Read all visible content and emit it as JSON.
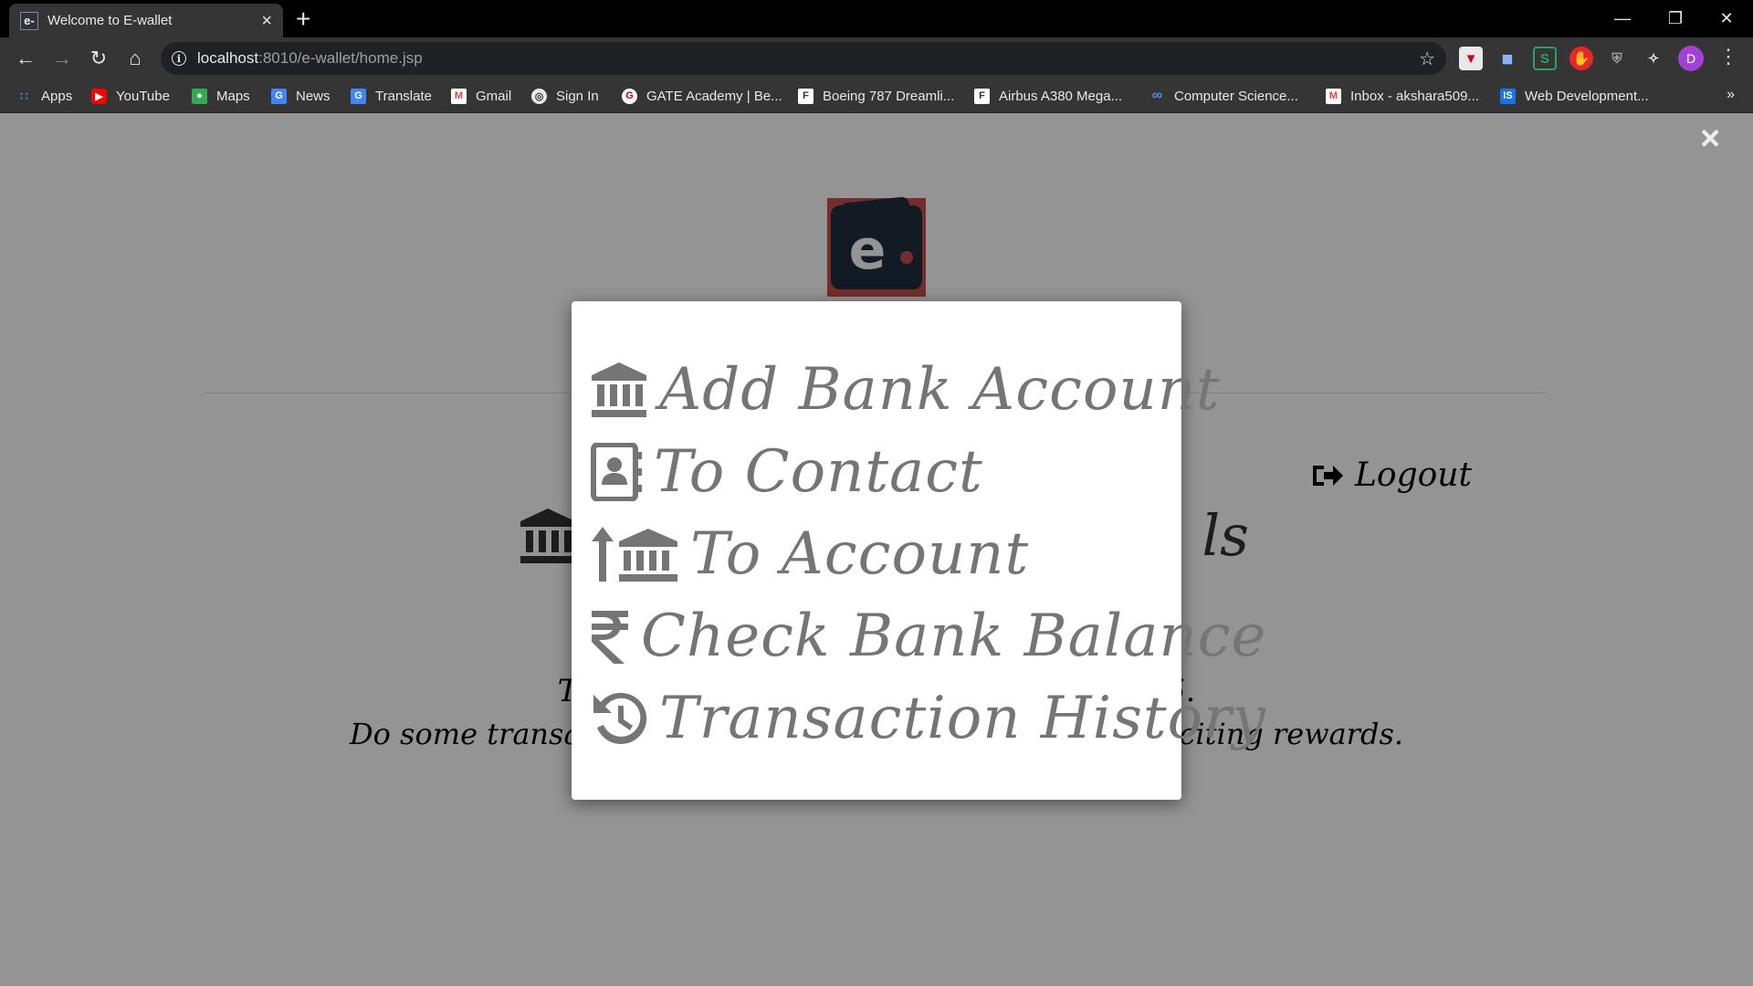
{
  "browser": {
    "tab_title": "Welcome to E-wallet",
    "tab_favicon": "e-",
    "url_host": "localhost",
    "url_path": ":8010/e-wallet/home.jsp",
    "profile_initial": "D",
    "bookmarks": [
      {
        "label": "Apps",
        "icon": "apps-grid-icon"
      },
      {
        "label": "YouTube",
        "icon": "youtube-icon"
      },
      {
        "label": "Maps",
        "icon": "maps-icon"
      },
      {
        "label": "News",
        "icon": "news-icon"
      },
      {
        "label": "Translate",
        "icon": "translate-icon"
      },
      {
        "label": "Gmail",
        "icon": "gmail-icon"
      },
      {
        "label": "Sign In",
        "icon": "globe-icon"
      },
      {
        "label": "GATE Academy | Be...",
        "icon": "gate-icon"
      },
      {
        "label": "Boeing 787 Dreamli...",
        "icon": "document-icon"
      },
      {
        "label": "Airbus A380 Mega...",
        "icon": "document-icon"
      },
      {
        "label": "Computer Science...",
        "icon": "infinity-icon"
      },
      {
        "label": "Inbox - akshara509...",
        "icon": "gmail-icon"
      },
      {
        "label": "Web Development...",
        "icon": "is-icon"
      }
    ],
    "bookmarks_more": "»"
  },
  "page": {
    "heading_right": "ls",
    "points_line1_left": "Th",
    "points_line1_right": "25.",
    "points_line2_left": "Do some transac",
    "points_line2_right": "exciting rewards.",
    "logout_label": "Logout",
    "close_label": "×"
  },
  "modal": {
    "items": [
      {
        "label": "Add Bank Account",
        "icon": "bank-icon"
      },
      {
        "label": "To Contact",
        "icon": "contact-book-icon"
      },
      {
        "label": "To Account",
        "icon": "bank-transfer-icon"
      },
      {
        "label": "Check Bank Balance",
        "icon": "rupee-icon"
      },
      {
        "label": "Transaction History",
        "icon": "history-icon"
      }
    ]
  },
  "colors": {
    "overlay": "#959595",
    "modal_text": "#757575",
    "logo_bg": "#c94f4f",
    "logo_wallet": "#1f2d3d",
    "profile": "#a142d4"
  }
}
